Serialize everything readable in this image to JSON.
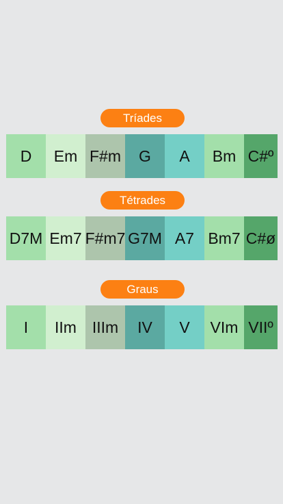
{
  "sections": [
    {
      "title": "Tríades",
      "items": [
        "D",
        "Em",
        "F#m",
        "G",
        "A",
        "Bm",
        "C#º"
      ]
    },
    {
      "title": "Tétrades",
      "items": [
        "D7M",
        "Em7",
        "F#m7",
        "G7M",
        "A7",
        "Bm7",
        "C#ø"
      ]
    },
    {
      "title": "Graus",
      "items": [
        "I",
        "IIm",
        "IIIm",
        "IV",
        "V",
        "VIm",
        "VIIº"
      ]
    }
  ],
  "colors": {
    "background": "#e6e7e8",
    "pill": "#fc8013",
    "cells": [
      "#a3dfaa",
      "#d1efcf",
      "#adc5ac",
      "#5ba9a1",
      "#74cfc6",
      "#a3dfaa",
      "#55a66a"
    ]
  }
}
